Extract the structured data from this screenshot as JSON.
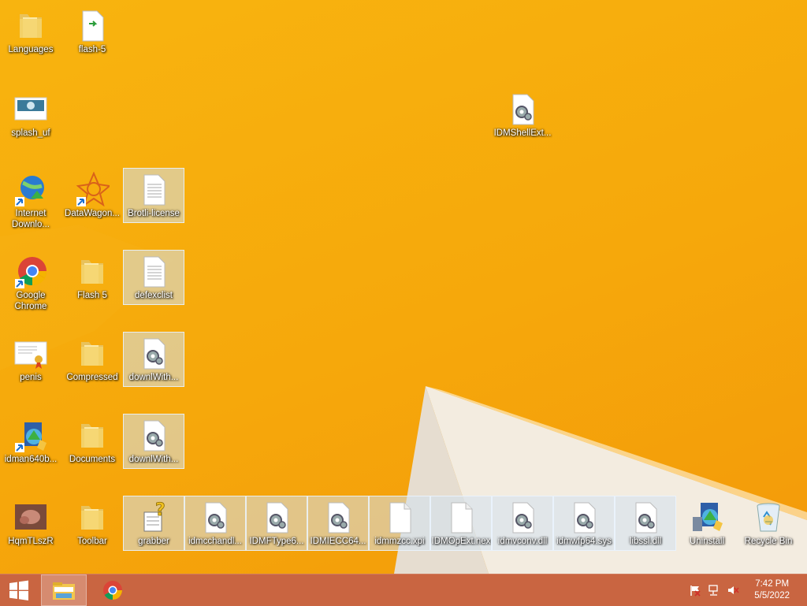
{
  "desktop": {
    "icons": [
      {
        "id": "languages",
        "label": "Languages",
        "icon": "folder-icon"
      },
      {
        "id": "flash5file",
        "label": "flash-5",
        "icon": "file-icon"
      },
      {
        "id": "splash",
        "label": "splash_uf",
        "icon": "image-icon"
      },
      {
        "id": "idmshell",
        "label": "IDMShellExt...",
        "icon": "dll-file-icon"
      },
      {
        "id": "idm",
        "label": "Internet Downlo...",
        "icon": "idm-globe-icon"
      },
      {
        "id": "datawagon",
        "label": "DataWagon...",
        "icon": "datawagon-icon"
      },
      {
        "id": "brotli",
        "label": "Brotli-license",
        "icon": "text-file-icon"
      },
      {
        "id": "chrome",
        "label": "Google Chrome",
        "icon": "chrome-icon"
      },
      {
        "id": "flash5folder",
        "label": "Flash 5",
        "icon": "folder-icon"
      },
      {
        "id": "defexclist",
        "label": "defexclist",
        "icon": "text-file-icon"
      },
      {
        "id": "penis",
        "label": "penis",
        "icon": "certificate-icon"
      },
      {
        "id": "compressed",
        "label": "Compressed",
        "icon": "folder-icon"
      },
      {
        "id": "downlwith1",
        "label": "downlWith...",
        "icon": "dll-file-icon"
      },
      {
        "id": "idman",
        "label": "idman640b...",
        "icon": "installer-icon"
      },
      {
        "id": "documents",
        "label": "Documents",
        "icon": "folder-icon"
      },
      {
        "id": "downlwith2",
        "label": "downlWith...",
        "icon": "dll-file-icon"
      },
      {
        "id": "hqm",
        "label": "HqmTLszR",
        "icon": "photo-icon"
      },
      {
        "id": "toolbar",
        "label": "Toolbar",
        "icon": "folder-icon"
      },
      {
        "id": "grabber",
        "label": "grabber",
        "icon": "unknown-file-icon"
      },
      {
        "id": "idmcchandl",
        "label": "idmcchandl...",
        "icon": "dll-file-icon"
      },
      {
        "id": "idmftype",
        "label": "IDMFType6...",
        "icon": "dll-file-icon"
      },
      {
        "id": "idmiecc",
        "label": "IDMIECC64...",
        "icon": "dll-file-icon"
      },
      {
        "id": "idmmzcc",
        "label": "idmmzcc.xpi",
        "icon": "blank-file-icon"
      },
      {
        "id": "idmopext",
        "label": "IDMOpExt.nex",
        "icon": "blank-file-icon"
      },
      {
        "id": "idmvconv",
        "label": "idmvconv.dll",
        "icon": "dll-file-icon"
      },
      {
        "id": "idmwfp",
        "label": "idmwfp64.sys",
        "icon": "dll-file-icon"
      },
      {
        "id": "libssl",
        "label": "libssl.dll",
        "icon": "dll-file-icon"
      },
      {
        "id": "uninstall",
        "label": "Uninstall",
        "icon": "installer-icon"
      },
      {
        "id": "recycle",
        "label": "Recycle Bin",
        "icon": "recycle-bin-icon"
      }
    ]
  },
  "taskbar": {
    "start_icon": "windows-logo-icon",
    "pinned": [
      {
        "name": "file-explorer",
        "icon": "file-explorer-icon",
        "active": true
      },
      {
        "name": "chrome",
        "icon": "chrome-icon",
        "active": false
      }
    ],
    "tray": [
      "action-center-flag-icon",
      "network-icon",
      "volume-muted-icon"
    ],
    "clock": {
      "time": "7:42 PM",
      "date": "5/5/2022"
    }
  },
  "colors": {
    "wallpaper": "#f6a80b",
    "taskbar": "#c46046",
    "selection": "#d2e1f0"
  }
}
